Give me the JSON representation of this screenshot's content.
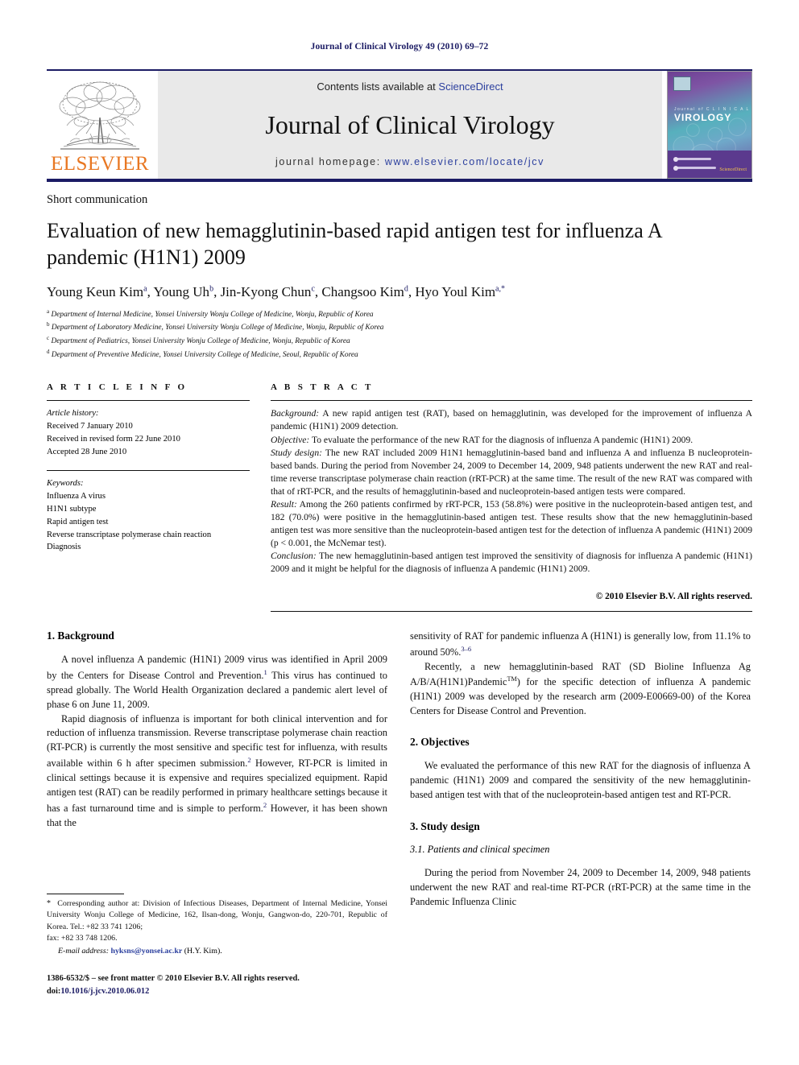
{
  "running_head": "Journal of Clinical Virology 49 (2010) 69–72",
  "masthead": {
    "contents_prefix": "Contents lists available at ",
    "sciencedirect": "ScienceDirect",
    "journal_title": "Journal of Clinical Virology",
    "homepage_prefix": "journal homepage:",
    "homepage_url": "www.elsevier.com/locate/jcv",
    "publisher_wordmark": "ELSEVIER",
    "cover": {
      "subtitle": "Journal of C L I N I C A L",
      "title": "VIROLOGY",
      "sd_logo": "ScienceDirect"
    },
    "colors": {
      "rule": "#1b1b64",
      "elsevier_orange": "#E87722",
      "link_blue": "#2b3f9e",
      "panel_gray": "#e9e9e9"
    }
  },
  "article": {
    "doctype": "Short communication",
    "title": "Evaluation of new hemagglutinin-based rapid antigen test for influenza A pandemic (H1N1) 2009",
    "authors_html": "Young Keun Kim<sup>a</sup>, Young Uh<sup>b</sup>, Jin-Kyong Chun<sup>c</sup>, Changsoo Kim<sup>d</sup>, Hyo Youl Kim<sup>a,*</sup>",
    "affiliations": [
      {
        "mark": "a",
        "text": "Department of Internal Medicine, Yonsei University Wonju College of Medicine, Wonju, Republic of Korea"
      },
      {
        "mark": "b",
        "text": "Department of Laboratory Medicine, Yonsei University Wonju College of Medicine, Wonju, Republic of Korea"
      },
      {
        "mark": "c",
        "text": "Department of Pediatrics, Yonsei University Wonju College of Medicine, Wonju, Republic of Korea"
      },
      {
        "mark": "d",
        "text": "Department of Preventive Medicine, Yonsei University College of Medicine, Seoul, Republic of Korea"
      }
    ]
  },
  "article_info": {
    "heading": "A R T I C L E   I N F O",
    "history_label": "Article history:",
    "history": [
      "Received 7 January 2010",
      "Received in revised form 22 June 2010",
      "Accepted 28 June 2010"
    ],
    "keywords_label": "Keywords:",
    "keywords": [
      "Influenza A virus",
      "H1N1 subtype",
      "Rapid antigen test",
      "Reverse transcriptase polymerase chain reaction",
      "Diagnosis"
    ]
  },
  "abstract": {
    "heading": "A B S T R A C T",
    "sections": [
      {
        "label": "Background:",
        "text": " A new rapid antigen test (RAT), based on hemagglutinin, was developed for the improvement of influenza A pandemic (H1N1) 2009 detection."
      },
      {
        "label": "Objective:",
        "text": " To evaluate the performance of the new RAT for the diagnosis of influenza A pandemic (H1N1) 2009."
      },
      {
        "label": "Study design:",
        "text": " The new RAT included 2009 H1N1 hemagglutinin-based band and influenza A and influenza B nucleoprotein-based bands. During the period from November 24, 2009 to December 14, 2009, 948 patients underwent the new RAT and real-time reverse transcriptase polymerase chain reaction (rRT-PCR) at the same time. The result of the new RAT was compared with that of rRT-PCR, and the results of hemagglutinin-based and nucleoprotein-based antigen tests were compared."
      },
      {
        "label": "Result:",
        "text": " Among the 260 patients confirmed by rRT-PCR, 153 (58.8%) were positive in the nucleoprotein-based antigen test, and 182 (70.0%) were positive in the hemagglutinin-based antigen test. These results show that the new hemagglutinin-based antigen test was more sensitive than the nucleoprotein-based antigen test for the detection of influenza A pandemic (H1N1) 2009 (p < 0.001, the McNemar test)."
      },
      {
        "label": "Conclusion:",
        "text": " The new hemagglutinin-based antigen test improved the sensitivity of diagnosis for influenza A pandemic (H1N1) 2009 and it might be helpful for the diagnosis of influenza A pandemic (H1N1) 2009."
      }
    ],
    "copyright": "© 2010 Elsevier B.V. All rights reserved."
  },
  "body": {
    "left": {
      "s1_heading": "1.  Background",
      "s1_p1_html": "A novel influenza A pandemic (H1N1) 2009 virus was identified in April 2009 by the Centers for Disease Control and Prevention.<sup>1</sup> This virus has continued to spread globally. The World Health Organization declared a pandemic alert level of phase 6 on June 11, 2009.",
      "s1_p2_html": "Rapid diagnosis of influenza is important for both clinical intervention and for reduction of influenza transmission. Reverse transcriptase polymerase chain reaction (RT-PCR) is currently the most sensitive and specific test for influenza, with results available within 6 h after specimen submission.<sup>2</sup> However, RT-PCR is limited in clinical settings because it is expensive and requires specialized equipment. Rapid antigen test (RAT) can be readily performed in primary healthcare settings because it has a fast turnaround time and is simple to perform.<sup>2</sup> However, it has been shown that the"
    },
    "right": {
      "cont_p_html": "sensitivity of RAT for pandemic influenza A (H1N1) is generally low, from 11.1% to around 50%.<sup>3–6</sup>",
      "p2_html": "Recently, a new hemagglutinin-based RAT (SD Bioline Influenza Ag A/B/A(H1N1)Pandemic<sup class=\"tm\">TM</sup>) for the specific detection of influenza A pandemic (H1N1) 2009 was developed by the research arm (2009-E00669-00) of the Korea Centers for Disease Control and Prevention.",
      "s2_heading": "2.  Objectives",
      "s2_p1": "We evaluated the performance of this new RAT for the diagnosis of influenza A pandemic (H1N1) 2009 and compared the sensitivity of the new hemagglutinin-based antigen test with that of the nucleoprotein-based antigen test and RT-PCR.",
      "s3_heading": "3.  Study design",
      "s31_heading": "3.1.  Patients and clinical specimen",
      "s31_p1": "During the period from November 24, 2009 to December 14, 2009, 948 patients underwent the new RAT and real-time RT-PCR (rRT-PCR) at the same time in the Pandemic Influenza Clinic"
    }
  },
  "footnote": {
    "corresponding_html": "<span class=\"star\">*</span>&nbsp; Corresponding author at: Division of Infectious Diseases, Department of Internal Medicine, Yonsei University Wonju College of Medicine, 162, Ilsan-dong, Wonju, Gangwon-do, 220-701, Republic of Korea. Tel.: +82 33 741 1206;",
    "fax_line": "fax: +82 33 748 1206.",
    "email_label": "E-mail address:",
    "email": "hyksns@yonsei.ac.kr",
    "email_owner": "(H.Y. Kim)."
  },
  "frontmatter": {
    "line1": "1386-6532/$ – see front matter © 2010 Elsevier B.V. All rights reserved.",
    "doi_prefix": "doi:",
    "doi": "10.1016/j.jcv.2010.06.012"
  }
}
